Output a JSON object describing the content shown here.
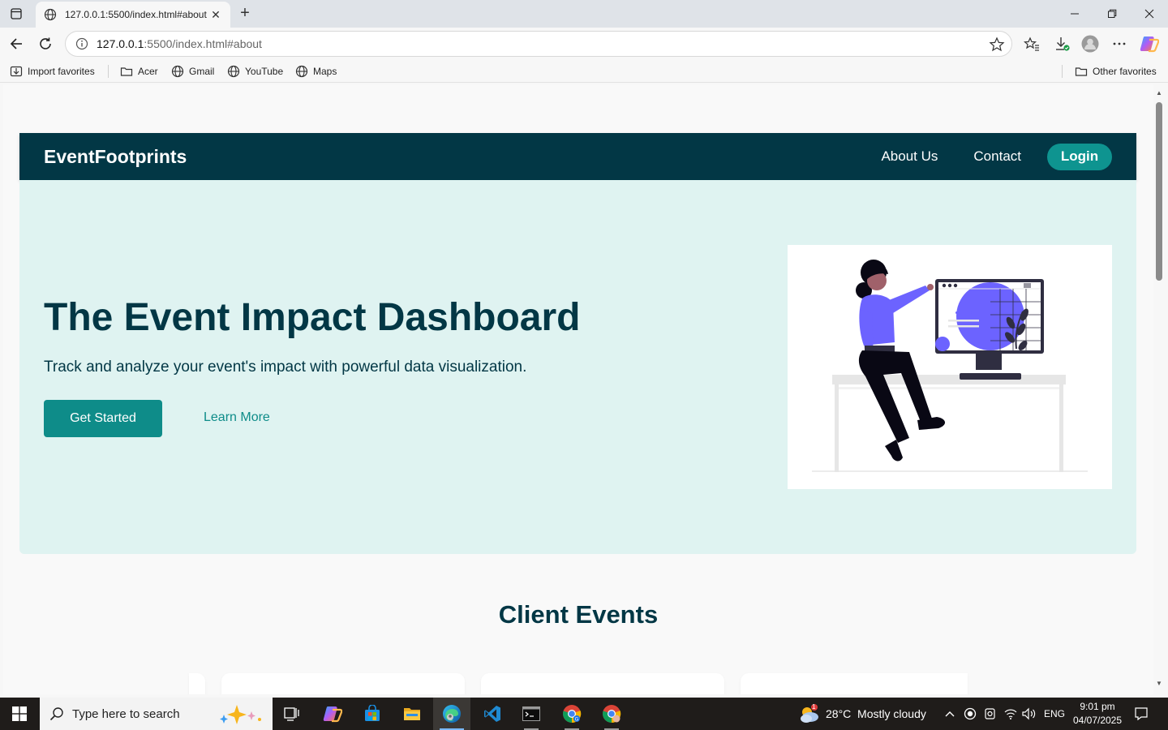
{
  "browser": {
    "tab_title": "127.0.0.1:5500/index.html#about",
    "url_host": "127.0.0.1",
    "url_path": ":5500/index.html#about",
    "favorites": [
      {
        "label": "Import favorites",
        "icon": "import-icon"
      },
      {
        "label": "Acer",
        "icon": "folder-icon"
      },
      {
        "label": "Gmail",
        "icon": "globe-icon"
      },
      {
        "label": "YouTube",
        "icon": "globe-icon"
      },
      {
        "label": "Maps",
        "icon": "globe-icon"
      }
    ],
    "other_favorites": "Other favorites"
  },
  "site": {
    "brand": "EventFootprints",
    "nav": {
      "about": "About Us",
      "contact": "Contact",
      "login": "Login"
    },
    "hero": {
      "title": "The Event Impact Dashboard",
      "subtitle": "Track and analyze your event's impact with powerful data visualization.",
      "primary_cta": "Get Started",
      "secondary_cta": "Learn More"
    },
    "section_title": "Client Events"
  },
  "taskbar": {
    "search_placeholder": "Type here to search",
    "weather": "28°C  Mostly cloudy",
    "weather_badge": "1",
    "language": "ENG",
    "time": "9:01 pm",
    "date": "04/07/2025"
  },
  "colors": {
    "nav_bg": "#023745",
    "accent": "#0e8c89",
    "hero_bg": "#dff3f1",
    "illustration_purple": "#6c63ff"
  }
}
